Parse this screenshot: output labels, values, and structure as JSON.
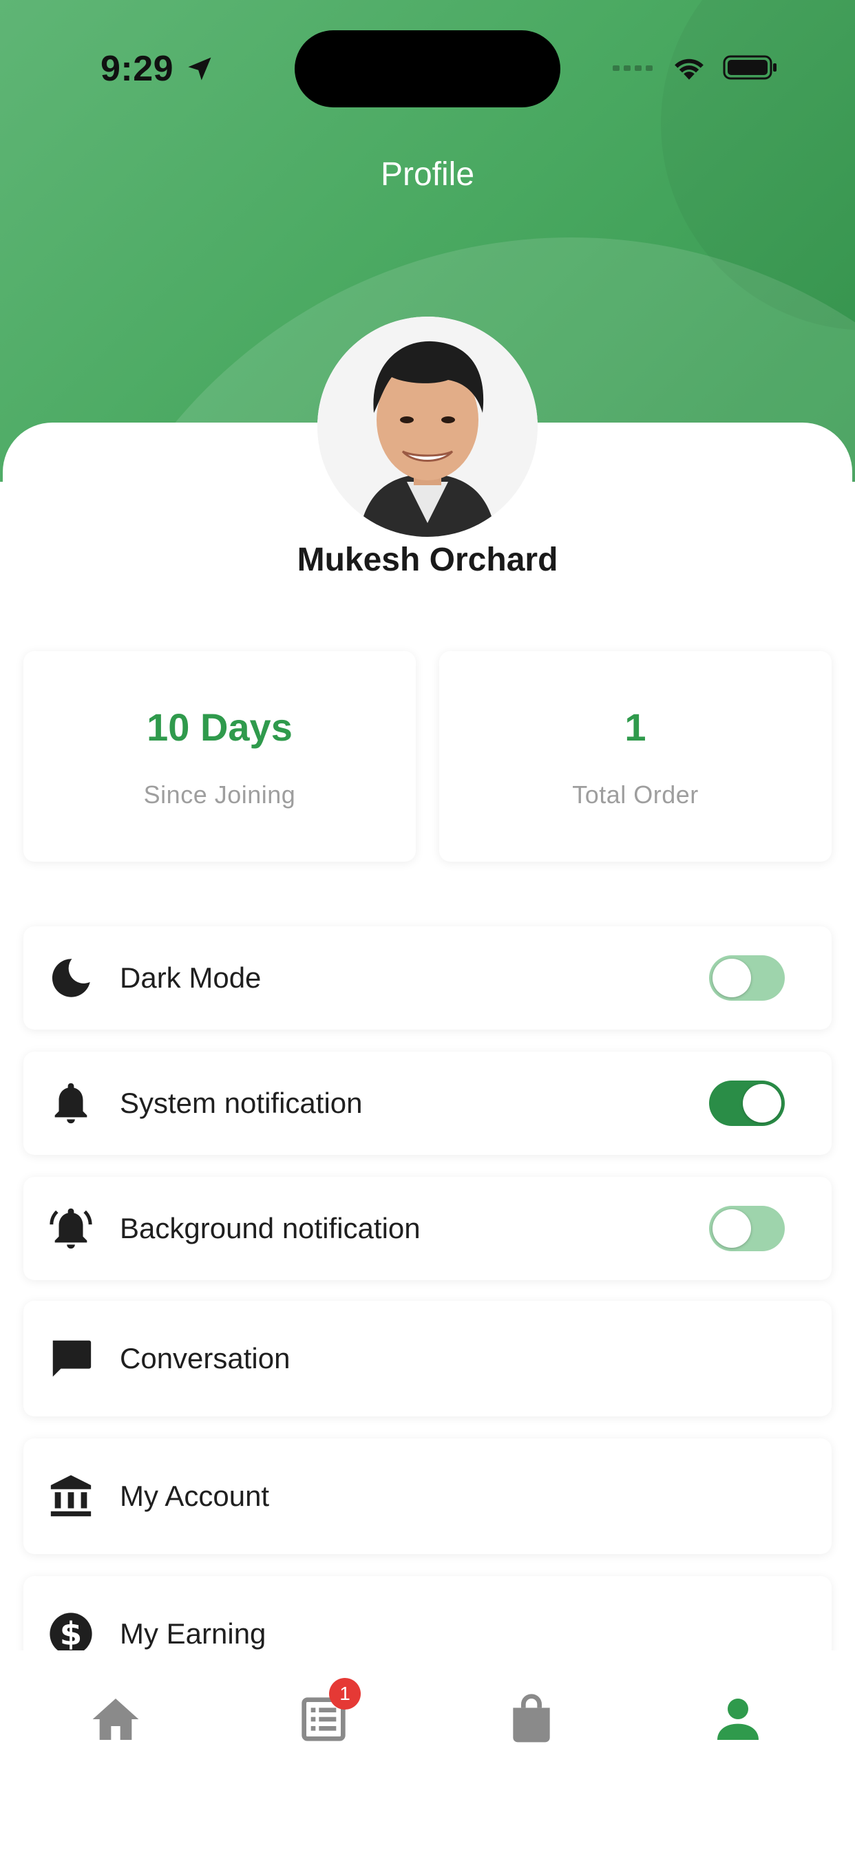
{
  "status_bar": {
    "time": "9:29"
  },
  "header": {
    "title": "Profile"
  },
  "profile": {
    "name": "Mukesh Orchard"
  },
  "stats": [
    {
      "value": "10 Days",
      "label": "Since Joining"
    },
    {
      "value": "1",
      "label": "Total Order"
    }
  ],
  "menu": [
    {
      "label": "Dark Mode",
      "icon": "moon-icon",
      "toggle": "off"
    },
    {
      "label": "System notification",
      "icon": "bell-icon",
      "toggle": "on"
    },
    {
      "label": "Background notification",
      "icon": "bell-ringing-icon",
      "toggle": "off"
    },
    {
      "label": "Conversation",
      "icon": "chat-icon"
    },
    {
      "label": "My Account",
      "icon": "bank-icon"
    },
    {
      "label": "My Earning",
      "icon": "dollar-icon"
    }
  ],
  "bottom_nav": {
    "items": [
      "home-icon",
      "orders-icon",
      "shopping-bag-icon",
      "person-icon"
    ],
    "active": "person-icon",
    "orders_badge": "1"
  },
  "colors": {
    "primary": "#2f9a4c",
    "header_green": "#4caa63",
    "badge": "#e53935"
  }
}
